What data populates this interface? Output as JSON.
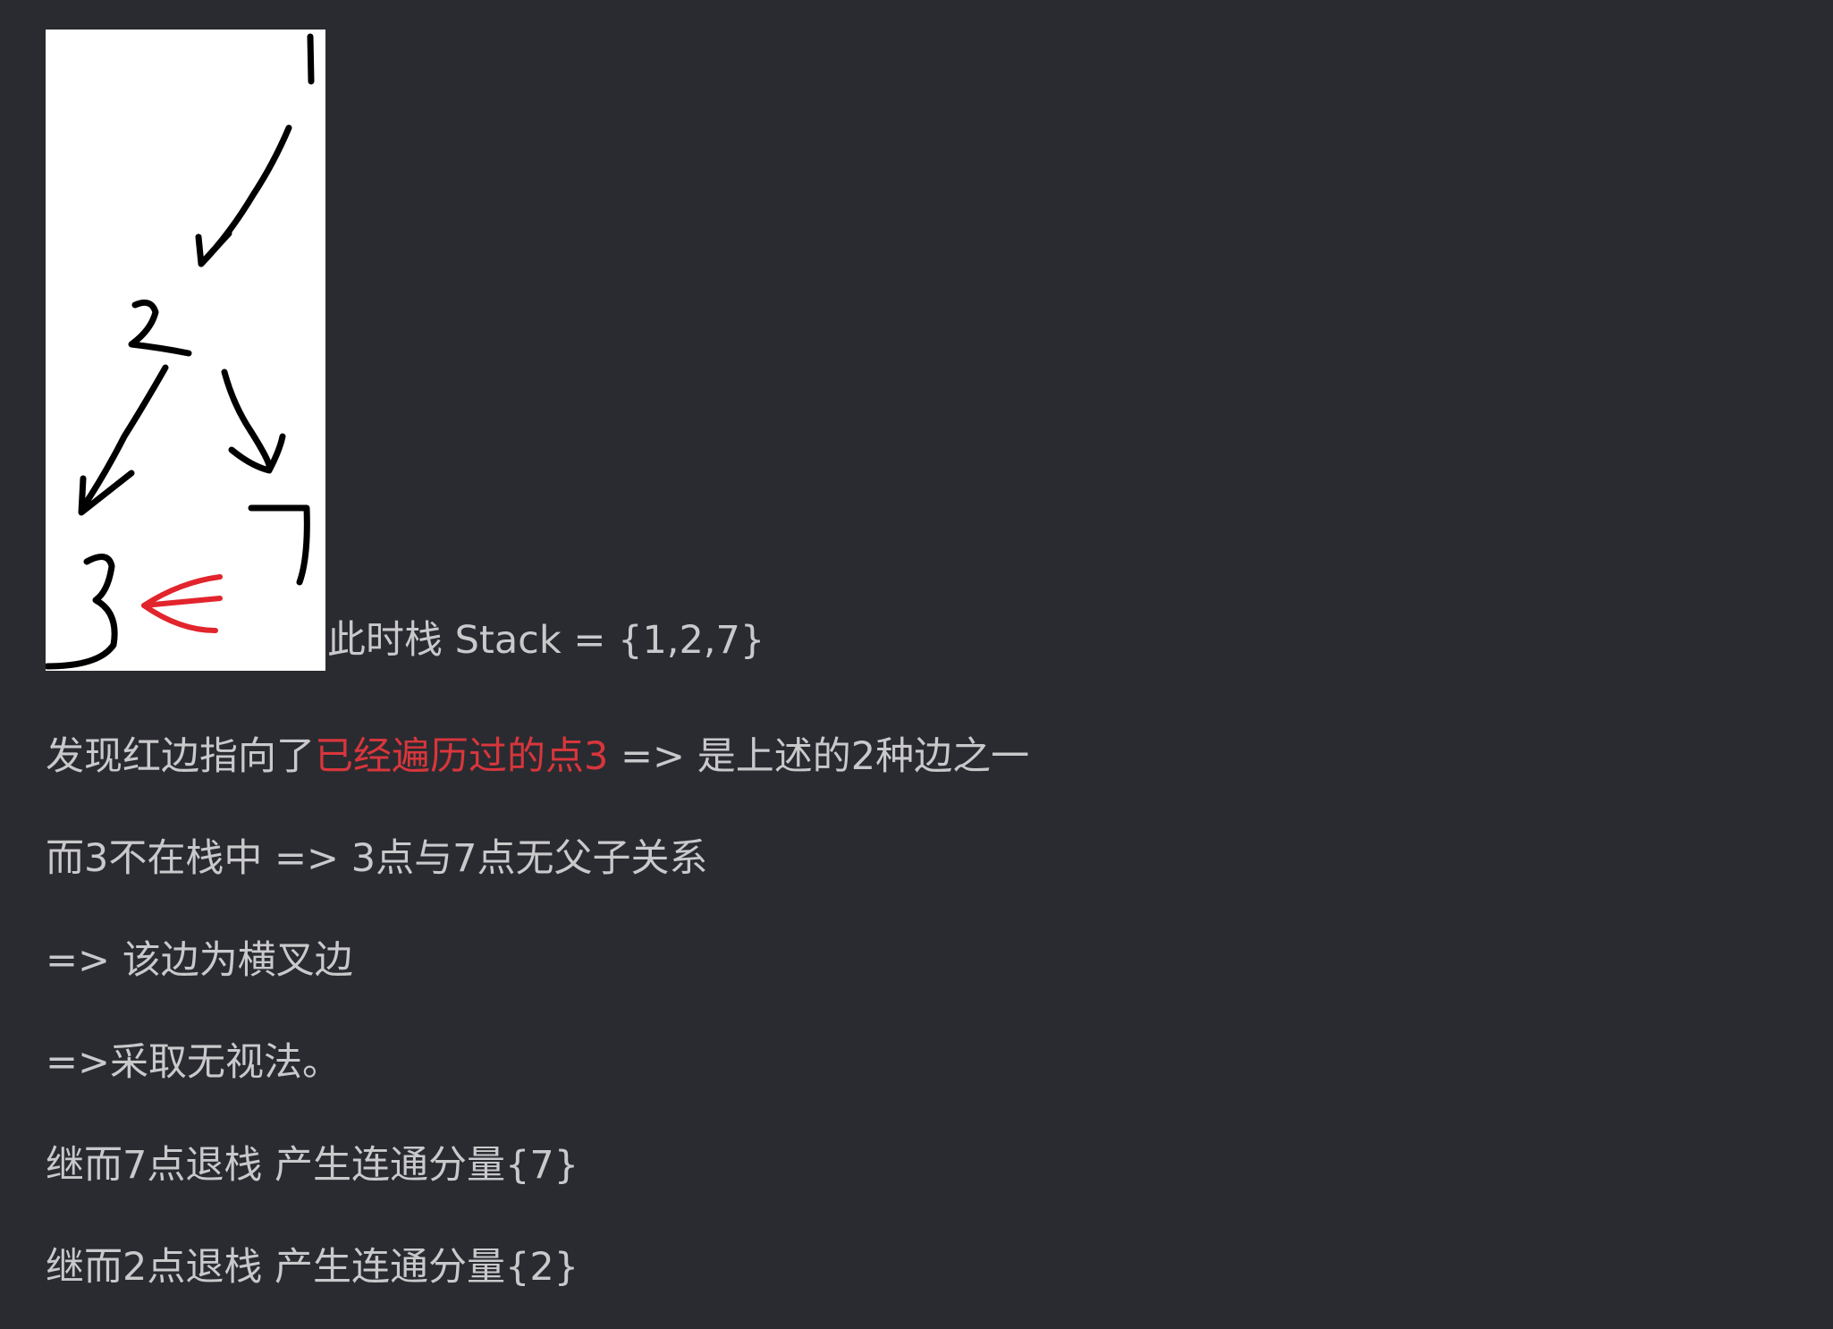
{
  "sketch": {
    "node_labels": {
      "top": "1",
      "middle": "2",
      "bottom_left": "3",
      "right": "7"
    },
    "colors": {
      "ink": "#000000",
      "highlight_arrow": "#e2242c",
      "background": "#ffffff"
    }
  },
  "caption": "此时栈 Stack = {1,2,7}",
  "paragraphs": {
    "p1_before": "发现红边指向了",
    "p1_highlight": "已经遍历过的点3",
    "p1_after": " => 是上述的2种边之一",
    "p2": "而3不在栈中 => 3点与7点无父子关系",
    "p3": "=> 该边为横叉边",
    "p4": "=>采取无视法。",
    "p5": "继而7点退栈 产生连通分量{7}",
    "p6": "继而2点退栈 产生连通分量{2}"
  },
  "colors": {
    "background": "#2a2b30",
    "text": "#c9c9cc",
    "highlight_text": "#d8363c"
  }
}
